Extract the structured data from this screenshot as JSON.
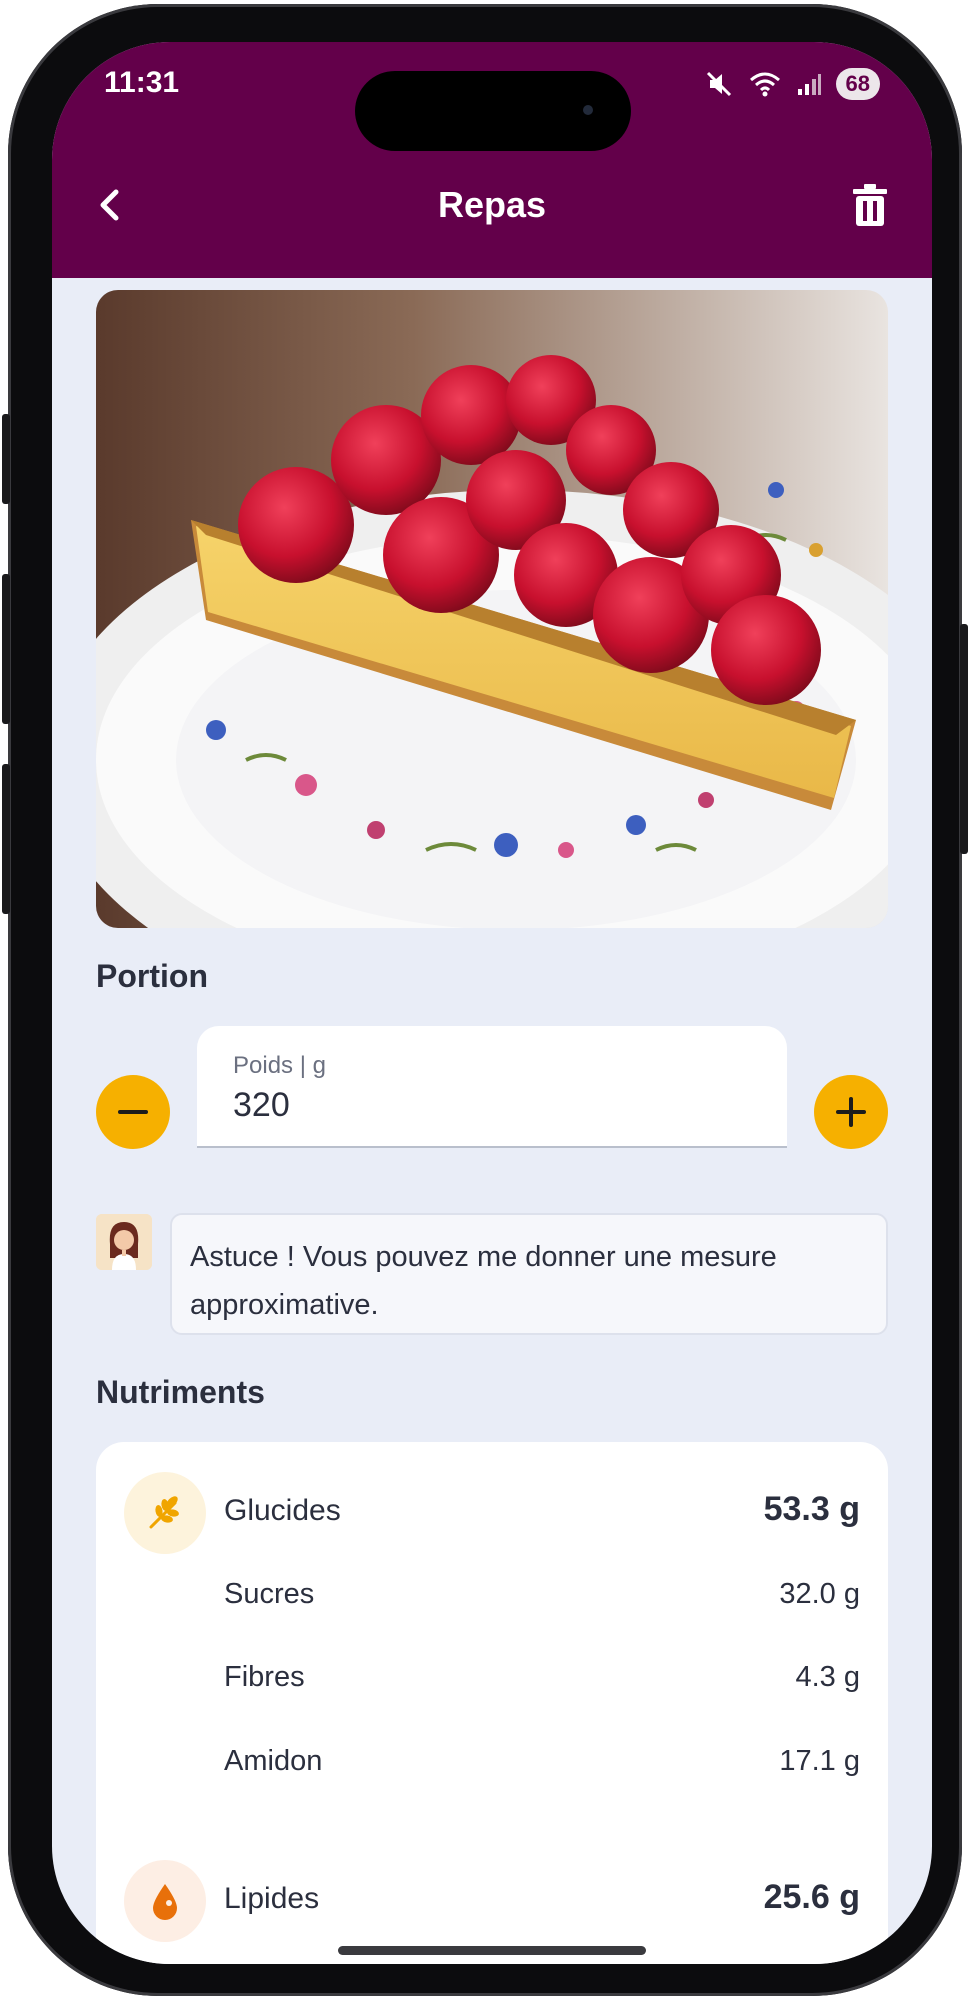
{
  "status_bar": {
    "time": "11:31",
    "battery": "68",
    "icons": [
      "mute-icon",
      "wifi-icon",
      "signal-icon"
    ]
  },
  "header": {
    "title": "Repas",
    "back_icon": "chevron-left-icon",
    "delete_icon": "trash-icon",
    "background_color": "#63004a"
  },
  "meal_photo": {
    "subject": "raspberry tart slice on floral plate"
  },
  "portion": {
    "section_title": "Portion",
    "field_label": "Poids | g",
    "field_value": "320",
    "decrease_symbol": "−",
    "increase_symbol": "+",
    "accent_color": "#f6b000"
  },
  "tip": {
    "text": "Astuce ! Vous pouvez me donner une mesure approximative."
  },
  "nutrients": {
    "section_title": "Nutriments",
    "items": [
      {
        "name": "Glucides",
        "value": "53.3 g",
        "icon": "wheat-icon"
      },
      {
        "name": "Sucres",
        "value": "32.0 g"
      },
      {
        "name": "Fibres",
        "value": "4.3 g"
      },
      {
        "name": "Amidon",
        "value": "17.1 g"
      },
      {
        "name": "Lipides",
        "value": "25.6 g",
        "icon": "drop-icon"
      }
    ]
  }
}
